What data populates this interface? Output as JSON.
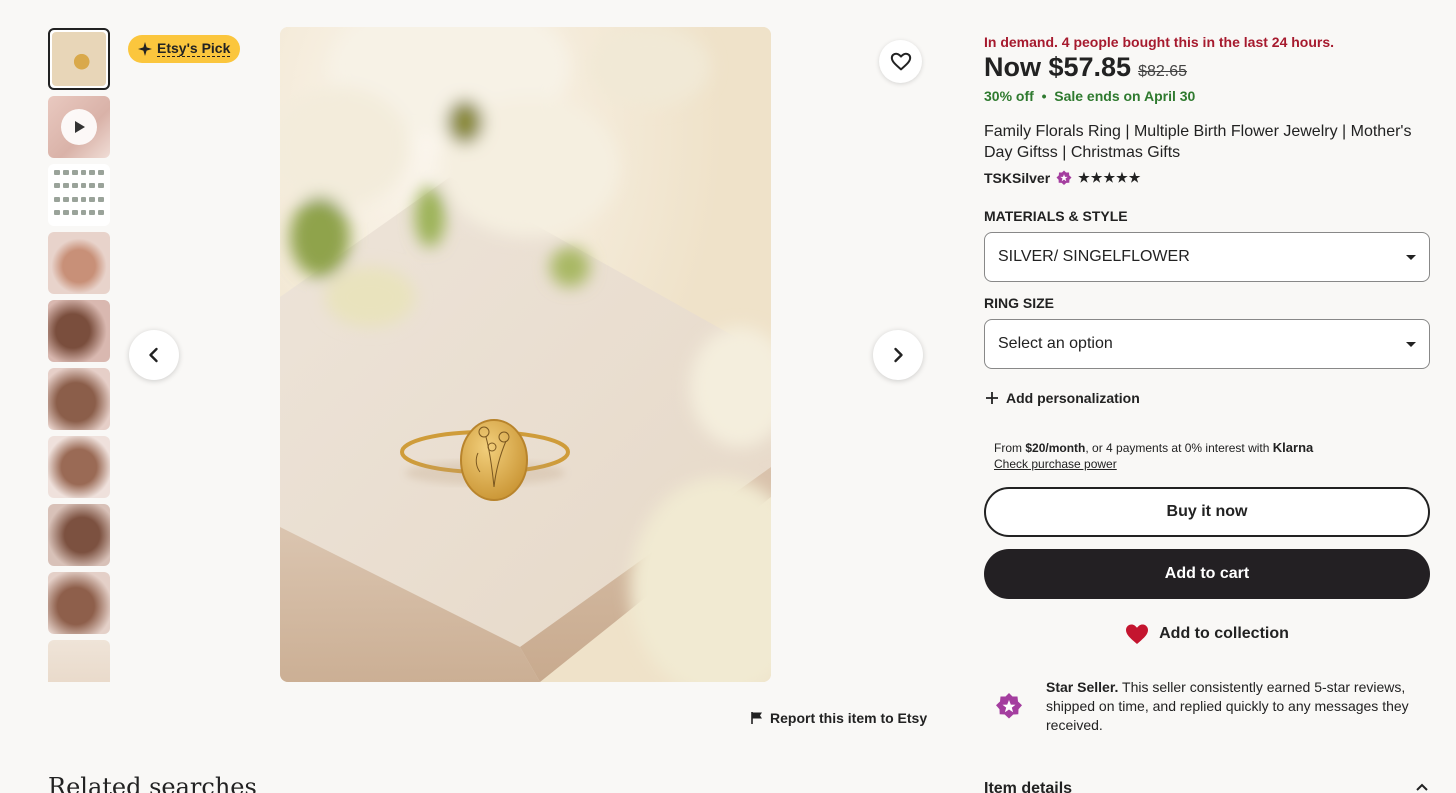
{
  "badge": {
    "label": "Etsy's Pick"
  },
  "gallery": {
    "thumbnail_count": 10
  },
  "product": {
    "demand_text": "In demand. 4 people bought this in the last 24 hours.",
    "price_now": "Now $57.85",
    "price_original": "$82.65",
    "sale_text": "30% off  •  Sale ends on April 30",
    "title": "Family Florals Ring | Multiple Birth Flower Jewelry | Mother's Day Giftss | Christmas Gifts",
    "shop_name": "TSKSilver",
    "rating_stars": "★★★★★"
  },
  "options": {
    "materials_label": "MATERIALS & STYLE",
    "materials_value": "SILVER/ SINGELFLOWER",
    "ring_size_label": "RING SIZE",
    "ring_size_value": "Select an option"
  },
  "personalization": {
    "label": "Add personalization"
  },
  "klarna": {
    "prefix": "From ",
    "amount": "$20/month",
    "middle": ", or 4 payments at 0% interest with ",
    "brand": "Klarna",
    "link": "Check purchase power"
  },
  "buttons": {
    "buy_now": "Buy it now",
    "add_to_cart": "Add to cart",
    "add_to_collection": "Add to collection"
  },
  "star_seller": {
    "title": "Star Seller.",
    "text": " This seller consistently earned 5-star reviews, shipped on time, and replied quickly to any messages they received."
  },
  "report": {
    "label": "Report this item to Etsy"
  },
  "related": {
    "heading": "Related searches"
  },
  "item_details": {
    "label": "Item details"
  },
  "colors": {
    "demand": "#a61a2e",
    "sale": "#2f7a2f",
    "badge": "#fbc63d",
    "dark_button": "#232023",
    "heart": "#c4152f",
    "star_seller": "#a43e9f"
  }
}
